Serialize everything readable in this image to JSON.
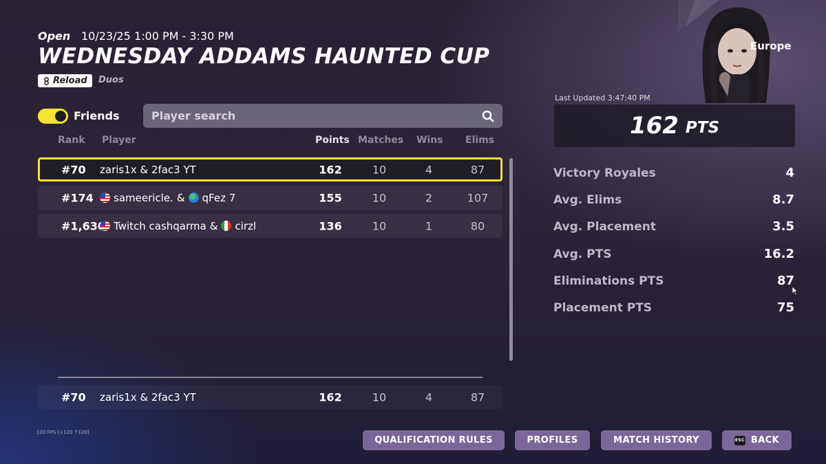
{
  "header": {
    "status": "Open",
    "date_range": "10/23/25 1:00 PM - 3:30 PM",
    "title": "WEDNESDAY ADDAMS HAUNTED CUP",
    "mode_tag": "Reload",
    "team_type": "Duos"
  },
  "filters": {
    "friends_label": "Friends",
    "friends_on": true,
    "search_placeholder": "Player search"
  },
  "table": {
    "columns": {
      "rank": "Rank",
      "player": "Player",
      "points": "Points",
      "matches": "Matches",
      "wins": "Wins",
      "elims": "Elims"
    },
    "rows": [
      {
        "rank": "#70",
        "player": "zaris1x & 2fac3 YT",
        "p1": "zaris1x",
        "p2": "2fac3 YT",
        "p1_flag": "",
        "p2_flag": "",
        "points": "162",
        "matches": "10",
        "wins": "4",
        "elims": "87",
        "selected": true
      },
      {
        "rank": "#174",
        "p1": "sameericle.",
        "p2": "qFez 7",
        "p1_flag": "us-flag-icon",
        "p2_flag": "globe-icon",
        "points": "155",
        "matches": "10",
        "wins": "2",
        "elims": "107",
        "selected": false
      },
      {
        "rank": "#1,630",
        "p1": "Twitch cashqarma",
        "p2": "cirzl",
        "p1_flag": "us-flag-icon",
        "p2_flag": "italy-flag-icon",
        "points": "136",
        "matches": "10",
        "wins": "1",
        "elims": "80",
        "selected": false
      }
    ],
    "pinned": {
      "rank": "#70",
      "player": "zaris1x & 2fac3 YT",
      "points": "162",
      "matches": "10",
      "wins": "4",
      "elims": "87"
    }
  },
  "panel": {
    "region": "Europe",
    "last_updated": "Last Updated 3:47:40 PM",
    "total_points": "162",
    "points_unit": "PTS",
    "stats": [
      {
        "label": "Victory Royales",
        "value": "4"
      },
      {
        "label": "Avg. Elims",
        "value": "8.7"
      },
      {
        "label": "Avg. Placement",
        "value": "3.5"
      },
      {
        "label": "Avg. PTS",
        "value": "16.2"
      },
      {
        "label": "Eliminations PTS",
        "value": "87"
      },
      {
        "label": "Placement PTS",
        "value": "75"
      }
    ]
  },
  "buttons": {
    "qualification_rules": "QUALIFICATION RULES",
    "profiles": "PROFILES",
    "match_history": "MATCH HISTORY",
    "back": "BACK",
    "esc_key": "ESC"
  },
  "fps": "120 FPS [↓120 ↑120]",
  "colors": {
    "accent_yellow": "#f2e531",
    "button_purple": "#7b669a"
  }
}
